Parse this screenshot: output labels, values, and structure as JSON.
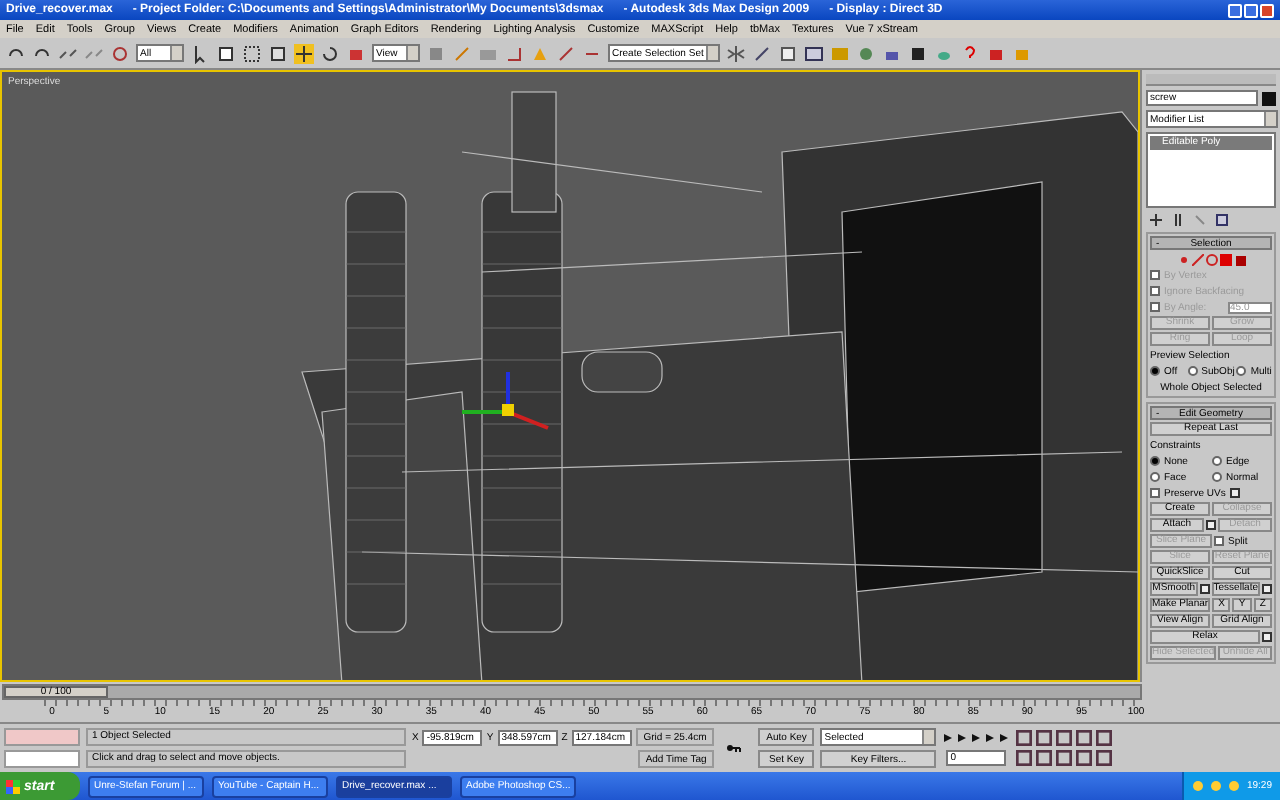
{
  "title_bar": {
    "file": "Drive_recover.max",
    "project": "- Project Folder: C:\\Documents and Settings\\Administrator\\My Documents\\3dsmax",
    "app": "- Autodesk 3ds Max Design 2009",
    "display": "- Display : Direct 3D"
  },
  "menu": [
    "File",
    "Edit",
    "Tools",
    "Group",
    "Views",
    "Create",
    "Modifiers",
    "Animation",
    "Graph Editors",
    "Rendering",
    "Lighting Analysis",
    "Customize",
    "MAXScript",
    "Help",
    "tbMax",
    "Textures",
    "Vue 7 xStream"
  ],
  "toolbar": {
    "filter": "All",
    "coord": "View",
    "selection_set": "Create Selection Set"
  },
  "viewport": {
    "label": "Perspective"
  },
  "command_panel": {
    "object_name": "screw",
    "modifier_list": "Modifier List",
    "stack": [
      {
        "label": "Editable Poly",
        "selected": true
      }
    ],
    "rollouts": [
      {
        "title": "Selection",
        "collapse": "-",
        "rows": [
          [
            {
              "kind": "check",
              "label": "By Vertex",
              "checked": false,
              "disabled": true
            }
          ],
          [
            {
              "kind": "check",
              "label": "Ignore Backfacing",
              "checked": false,
              "disabled": true
            }
          ],
          [
            {
              "kind": "check",
              "label": "By Angle:",
              "checked": false,
              "disabled": true
            },
            {
              "kind": "field",
              "label": "45.0",
              "disabled": true
            }
          ],
          [
            {
              "kind": "button",
              "label": "Shrink",
              "disabled": true
            },
            {
              "kind": "button",
              "label": "Grow",
              "disabled": true
            }
          ],
          [
            {
              "kind": "button",
              "label": "Ring",
              "disabled": true
            },
            {
              "kind": "button",
              "label": "Loop",
              "disabled": true
            }
          ],
          [
            {
              "kind": "legend",
              "label": "Preview Selection"
            }
          ],
          [
            {
              "kind": "radio",
              "label": "Off",
              "selected": true
            },
            {
              "kind": "radio",
              "label": "SubObj",
              "selected": false
            },
            {
              "kind": "radio",
              "label": "Multi",
              "selected": false
            }
          ],
          [
            {
              "kind": "text",
              "label": "Whole Object Selected"
            }
          ]
        ]
      },
      {
        "title": "Edit Geometry",
        "collapse": "-",
        "rows": [
          [
            {
              "kind": "button",
              "label": "Repeat Last",
              "disabled": false
            }
          ],
          [
            {
              "kind": "legend",
              "label": "Constraints"
            }
          ],
          [
            {
              "kind": "radio",
              "label": "None",
              "selected": true
            },
            {
              "kind": "radio",
              "label": "Edge",
              "selected": false
            }
          ],
          [
            {
              "kind": "radio",
              "label": "Face",
              "selected": false
            },
            {
              "kind": "radio",
              "label": "Normal",
              "selected": false
            }
          ],
          [
            {
              "kind": "check",
              "label": "Preserve UVs",
              "checked": false,
              "disabled": false,
              "options": true
            }
          ],
          [
            {
              "kind": "button",
              "label": "Create",
              "disabled": false
            },
            {
              "kind": "button",
              "label": "Collapse",
              "disabled": true
            }
          ],
          [
            {
              "kind": "button",
              "label": "Attach",
              "disabled": false,
              "options": true
            },
            {
              "kind": "button",
              "label": "Detach",
              "disabled": true
            }
          ],
          [
            {
              "kind": "button",
              "label": "Slice Plane",
              "disabled": true
            },
            {
              "kind": "check",
              "label": "Split",
              "checked": false,
              "disabled": false
            }
          ],
          [
            {
              "kind": "button",
              "label": "Slice",
              "disabled": true
            },
            {
              "kind": "button",
              "label": "Reset Plane",
              "disabled": true
            }
          ],
          [
            {
              "kind": "button",
              "label": "QuickSlice",
              "disabled": false
            },
            {
              "kind": "button",
              "label": "Cut",
              "disabled": false
            }
          ],
          [
            {
              "kind": "button",
              "label": "MSmooth",
              "disabled": false,
              "options": true
            },
            {
              "kind": "button",
              "label": "Tessellate",
              "disabled": false,
              "options": true
            }
          ],
          [
            {
              "kind": "button",
              "label": "Make Planar",
              "disabled": false
            },
            {
              "kind": "button",
              "label": "X",
              "disabled": false
            },
            {
              "kind": "button",
              "label": "Y",
              "disabled": false
            },
            {
              "kind": "button",
              "label": "Z",
              "disabled": false
            }
          ],
          [
            {
              "kind": "button",
              "label": "View Align",
              "disabled": false
            },
            {
              "kind": "button",
              "label": "Grid Align",
              "disabled": false
            }
          ],
          [
            {
              "kind": "button",
              "label": "Relax",
              "disabled": false,
              "options": true
            }
          ],
          [
            {
              "kind": "button",
              "label": "Hide Selected",
              "disabled": true
            },
            {
              "kind": "button",
              "label": "Unhide All",
              "disabled": true
            }
          ]
        ]
      }
    ]
  },
  "time_slider": {
    "label": "0 / 100",
    "level": 0
  },
  "track_bar": {
    "ticks": [
      "0",
      "5",
      "10",
      "15",
      "20",
      "25",
      "30",
      "35",
      "40",
      "45",
      "50",
      "55",
      "60",
      "65",
      "70",
      "75",
      "80",
      "85",
      "90",
      "95",
      "100"
    ]
  },
  "status": {
    "selection": "1 Object Selected",
    "prompt": "Click and drag to select and move objects.",
    "x_label": "X",
    "x": "-95.819cm",
    "y_label": "Y",
    "y": "348.597cm",
    "z_label": "Z",
    "z": "127.184cm",
    "grid": "Grid = 25.4cm",
    "time_tag": "Add Time Tag",
    "auto_key": "Auto Key",
    "set_key": "Set Key",
    "key_mode": "Selected",
    "key_filters": "Key Filters...",
    "frame": "0"
  },
  "taskbar": {
    "start": "start",
    "tasks": [
      {
        "label": "Unre-Stefan Forum | ...",
        "selected": false
      },
      {
        "label": "YouTube - Captain H...",
        "selected": false
      },
      {
        "label": "Drive_recover.max ...",
        "selected": true
      },
      {
        "label": "Adobe Photoshop CS...",
        "selected": false
      }
    ],
    "clock": "19:29"
  }
}
